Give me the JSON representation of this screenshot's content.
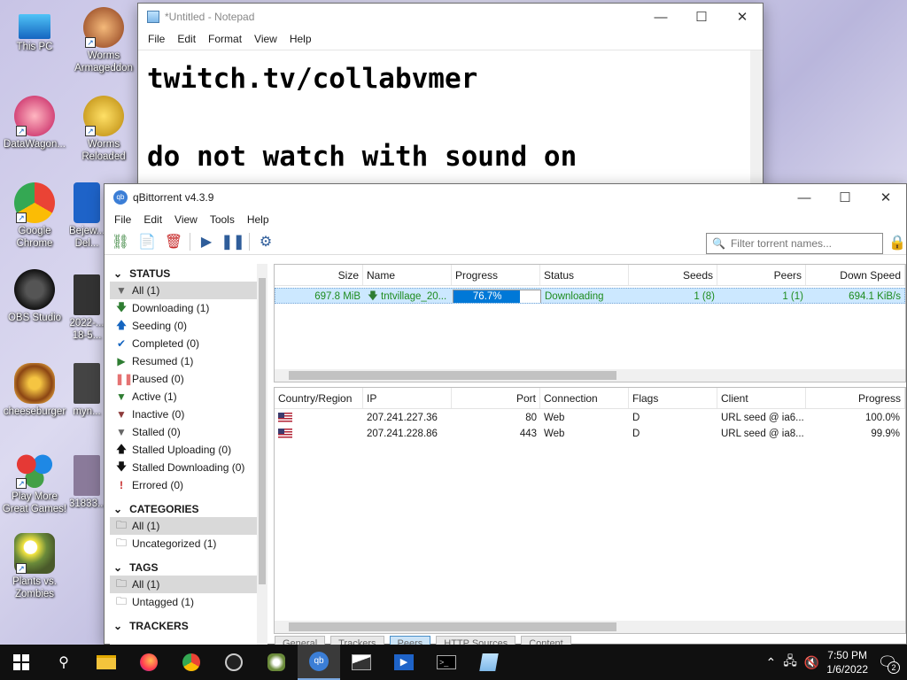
{
  "desktop": {
    "icons": [
      {
        "label": "This PC"
      },
      {
        "label": "Worms Armageddon"
      },
      {
        "label": "DataWagon..."
      },
      {
        "label": "Worms Reloaded"
      },
      {
        "label": "Google Chrome"
      },
      {
        "label": "Bejew... Del..."
      },
      {
        "label": "OBS Studio"
      },
      {
        "label": "2022-... 18-5..."
      },
      {
        "label": "cheeseburger"
      },
      {
        "label": "myn..."
      },
      {
        "label": "Play More Great Games!"
      },
      {
        "label": "31833..."
      },
      {
        "label": "Plants vs. Zombies"
      }
    ]
  },
  "notepad": {
    "title": "*Untitled - Notepad",
    "menu": [
      "File",
      "Edit",
      "Format",
      "View",
      "Help"
    ],
    "lines": [
      "twitch.tv/collabvmer",
      "",
      "do not watch with sound on"
    ]
  },
  "qbittorrent": {
    "title": "qBittorrent v4.3.9",
    "menu": [
      "File",
      "Edit",
      "View",
      "Tools",
      "Help"
    ],
    "filter_placeholder": "Filter torrent names...",
    "sidebar": {
      "status_header": "STATUS",
      "status_items": [
        {
          "label": "All (1)",
          "icon": "filter-icon",
          "selected": true
        },
        {
          "label": "Downloading (1)",
          "icon": "download-arrow-icon"
        },
        {
          "label": "Seeding (0)",
          "icon": "upload-arrow-icon"
        },
        {
          "label": "Completed (0)",
          "icon": "check-icon"
        },
        {
          "label": "Resumed (1)",
          "icon": "play-icon"
        },
        {
          "label": "Paused (0)",
          "icon": "pause-icon"
        },
        {
          "label": "Active (1)",
          "icon": "filter-icon"
        },
        {
          "label": "Inactive (0)",
          "icon": "filter-icon"
        },
        {
          "label": "Stalled (0)",
          "icon": "filter-icon"
        },
        {
          "label": "Stalled Uploading (0)",
          "icon": "upload-arrow-icon"
        },
        {
          "label": "Stalled Downloading (0)",
          "icon": "download-arrow-icon"
        },
        {
          "label": "Errored (0)",
          "icon": "error-icon"
        }
      ],
      "categories_header": "CATEGORIES",
      "categories": [
        {
          "label": "All (1)",
          "selected": true
        },
        {
          "label": "Uncategorized (1)"
        }
      ],
      "tags_header": "TAGS",
      "tags": [
        {
          "label": "All (1)",
          "selected": true
        },
        {
          "label": "Untagged (1)"
        }
      ],
      "trackers_header": "TRACKERS"
    },
    "torrents": {
      "headers": [
        "Size",
        "Name",
        "Progress",
        "Status",
        "Seeds",
        "Peers",
        "Down Speed"
      ],
      "rows": [
        {
          "size": "697.8 MiB",
          "name": "tntvillage_20...",
          "progress": "76.7%",
          "progress_value": 0.767,
          "status": "Downloading",
          "seeds": "1 (8)",
          "peers": "1 (1)",
          "down_speed": "694.1 KiB/s"
        }
      ]
    },
    "peers": {
      "headers": [
        "Country/Region",
        "IP",
        "Port",
        "Connection",
        "Flags",
        "Client",
        "Progress"
      ],
      "rows": [
        {
          "ip": "207.241.227.36",
          "port": "80",
          "connection": "Web",
          "flags": "D",
          "client": "URL seed @ ia6...",
          "progress": "100.0%"
        },
        {
          "ip": "207.241.228.86",
          "port": "443",
          "connection": "Web",
          "flags": "D",
          "client": "URL seed @ ia8...",
          "progress": "99.9%"
        }
      ]
    },
    "tabs": [
      "General",
      "Trackers",
      "Peers",
      "HTTP Sources",
      "Content"
    ],
    "active_tab": "Peers"
  },
  "taskbar": {
    "time": "7:50 PM",
    "date": "1/6/2022",
    "notification_count": "2"
  },
  "colors": {
    "selection": "#cce8ff",
    "progress_fill": "#0078d7",
    "status_green": "#1e8c1e"
  }
}
